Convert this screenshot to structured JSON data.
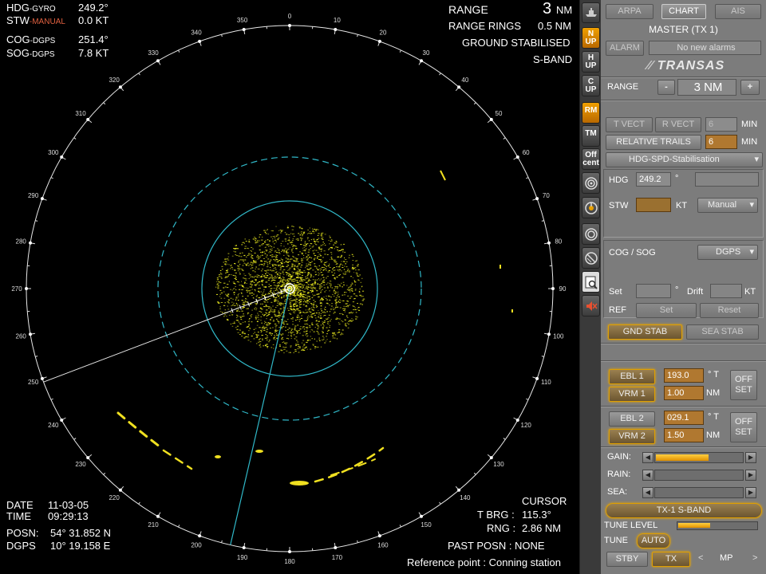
{
  "radar": {
    "hdg_label": "HDG",
    "hdg_src": "-GYRO",
    "hdg_value": "249.2°",
    "stw_label": "STW",
    "stw_src": "-MANUAL",
    "stw_value": "0.0 KT",
    "cog_label": "COG",
    "cog_src": "-DGPS",
    "cog_value": "251.4°",
    "sog_label": "SOG",
    "sog_src": "-DGPS",
    "sog_value": "7.8 KT",
    "range_label": "RANGE",
    "range_value": "3",
    "range_unit": "NM",
    "rings_label": "RANGE RINGS",
    "rings_value": "0.5 NM",
    "stabilised": "GROUND STABILISED",
    "band": "S-BAND",
    "date_label": "DATE",
    "date_value": "11-03-05",
    "time_label": "TIME",
    "time_value": "09:29:13",
    "posn_label": "POSN:",
    "posn_value": "54° 31.852 N",
    "dgps_label": "DGPS",
    "dgps_value": "10° 19.158 E",
    "cursor_label": "CURSOR",
    "tbrg_label": "T BRG :",
    "tbrg_value": "115.3°",
    "rng_label": "RNG :",
    "rng_value": "2.86 NM",
    "past_posn": "PAST POSN : NONE",
    "ref_point": "Reference point : Conning station",
    "bearings": [
      "0",
      "10",
      "20",
      "30",
      "40",
      "50",
      "60",
      "70",
      "80",
      "90",
      "100",
      "110",
      "120",
      "130",
      "140",
      "150",
      "160",
      "170",
      "180",
      "190",
      "200",
      "210",
      "220",
      "230",
      "240",
      "250",
      "260",
      "270",
      "280",
      "290",
      "300",
      "310",
      "320",
      "330",
      "340",
      "350"
    ],
    "heading_deg": 249.2,
    "ebl_deg": 193.0,
    "vrm1_nm": 1.0,
    "vrm2_nm": 1.5
  },
  "toolbar": {
    "n_up": [
      "N",
      "UP"
    ],
    "h_up": [
      "H",
      "UP"
    ],
    "c_up": [
      "C",
      "UP"
    ],
    "rm": "RM",
    "tm": "TM",
    "off_cent": [
      "Off",
      "cent"
    ]
  },
  "panel": {
    "arpa": "ARPA",
    "chart": "CHART",
    "ais": "AIS",
    "master": "MASTER (TX 1)",
    "alarm": "ALARM",
    "alarm_msg": "No new alarms",
    "logo": "TRANSAS",
    "range_label": "RANGE",
    "range_minus": "-",
    "range_value": "3 NM",
    "range_plus": "+",
    "t_vect": "T VECT",
    "r_vect": "R VECT",
    "vect_min": "6",
    "min1": "MIN",
    "rel_trails": "RELATIVE TRAILS",
    "trails_min": "6",
    "min2": "MIN",
    "stab_mode": "HDG-SPD-Stabilisation",
    "hdg_label": "HDG",
    "hdg_value": "249.2",
    "deg1": "°",
    "stw_label": "STW",
    "kt1": "KT",
    "manual": "Manual",
    "cog_sog": "COG / SOG",
    "dgps": "DGPS",
    "set_label": "Set",
    "deg2": "°",
    "drift_label": "Drift",
    "kt2": "KT",
    "ref_label": "REF",
    "set_btn": "Set",
    "reset_btn": "Reset",
    "gnd_stab": "GND STAB",
    "sea_stab": "SEA STAB",
    "ebl1": "EBL 1",
    "ebl1_value": "193.0",
    "deg_t1": "° T",
    "vrm1": "VRM 1",
    "vrm1_value": "1.00",
    "nm1": "NM",
    "offset1": "OFF SET",
    "ebl2": "EBL 2",
    "ebl2_value": "029.1",
    "deg_t2": "° T",
    "vrm2": "VRM 2",
    "vrm2_value": "1.50",
    "nm2": "NM",
    "offset2": "OFF SET",
    "gain_label": "GAIN:",
    "gain_level": 0.6,
    "rain_label": "RAIN:",
    "rain_level": 0.0,
    "sea_label": "SEA:",
    "sea_level": 0.0,
    "tx_band": "TX-1  S-BAND",
    "tune_level_label": "TUNE LEVEL",
    "tune_level": 0.4,
    "tune_label": "TUNE",
    "auto": "AUTO",
    "stby": "STBY",
    "tx": "TX",
    "prev": "<",
    "mp": "MP",
    "next": ">"
  }
}
